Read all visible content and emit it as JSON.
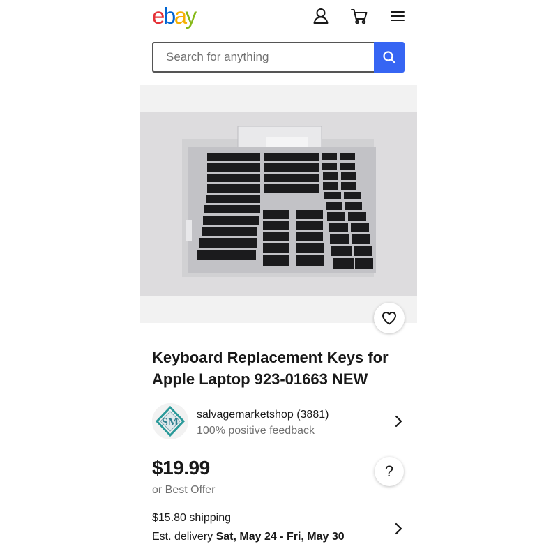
{
  "header": {
    "logo": {
      "e": "e",
      "b": "b",
      "a": "a",
      "y": "y"
    },
    "icons": [
      "user-icon",
      "cart-icon",
      "menu-icon"
    ]
  },
  "search": {
    "placeholder": "Search for anything",
    "button_icon": "search-icon"
  },
  "gallery": {
    "favorite_icon": "heart-icon"
  },
  "listing": {
    "title": "Keyboard Replacement Keys for Apple Laptop 923-01663 NEW"
  },
  "seller": {
    "name": "salvagemarketshop (3881)",
    "feedback": "100% positive feedback",
    "avatar_text": "SM"
  },
  "price": {
    "amount": "$19.99",
    "offer": "or Best Offer",
    "help_label": "?"
  },
  "shipping": {
    "cost": "$15.80 shipping",
    "delivery_prefix": "Est. delivery",
    "delivery_dates": "Sat, May 24 - Fri, May 30"
  },
  "colors": {
    "logo_e": "#e53238",
    "logo_b": "#0064d2",
    "logo_a": "#f5af02",
    "logo_y": "#86b817",
    "search_button": "#3665f3",
    "text": "#191919",
    "secondary_text": "#707070"
  }
}
